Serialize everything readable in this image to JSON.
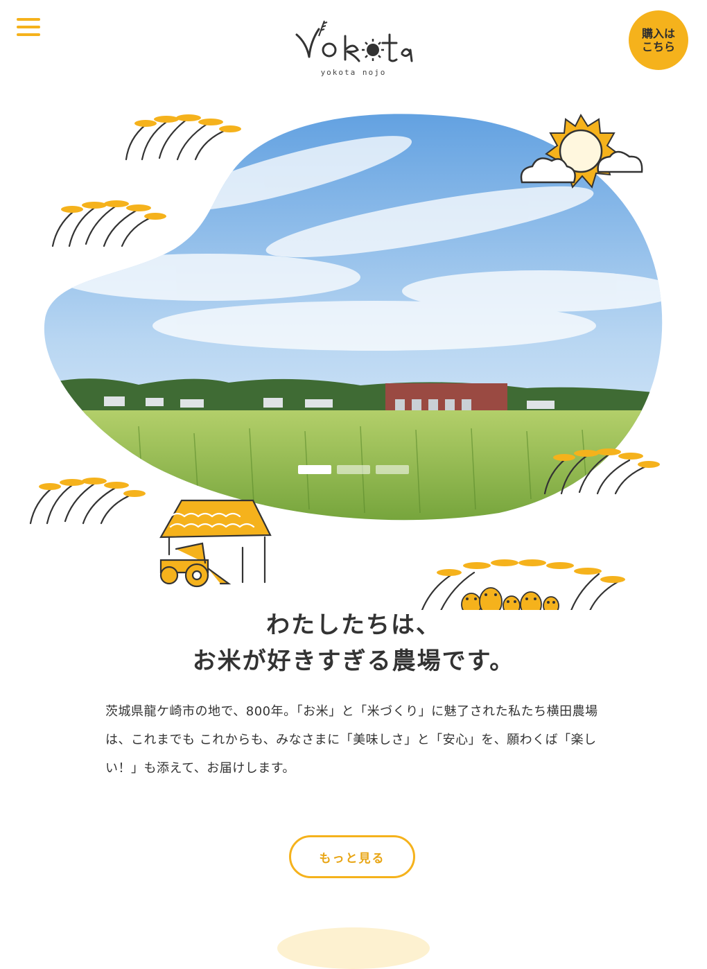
{
  "header": {
    "logo_text": "yokota",
    "logo_sub": "yokota nojo",
    "buy_label": "購入は\nこちら"
  },
  "hero": {
    "slide_count": 3,
    "active_slide": 1
  },
  "intro": {
    "headline_line1": "わたしたちは、",
    "headline_line2": "お米が好きすぎる農場です。",
    "body": "茨城県龍ケ崎市の地で、800年。「お米」と「米づくり」に魅了された私たち横田農場は、これまでも これからも、みなさまに「美味しさ」と「安心」を、願わくば「楽しい！」も添えて、お届けします。",
    "more_label": "もっと見る"
  },
  "colors": {
    "accent": "#f5b21c",
    "text": "#333333",
    "sky": "#7fb4e4",
    "field": "#8bb242"
  },
  "icons": [
    "menu-icon",
    "sun-icon",
    "rice-plant-icon",
    "tractor-shed-icon",
    "frogs-icon"
  ]
}
